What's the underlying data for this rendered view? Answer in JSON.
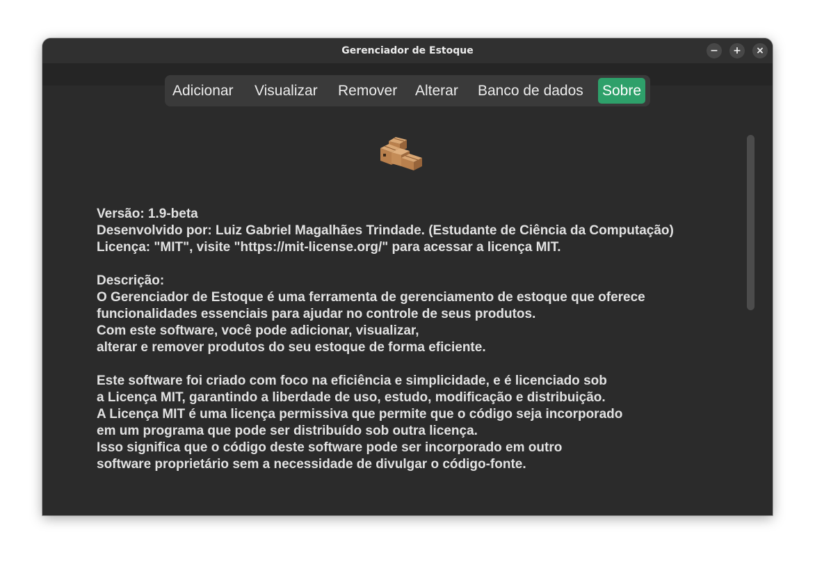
{
  "window": {
    "title": "Gerenciador de Estoque"
  },
  "window_controls": {
    "minimize": "−",
    "maximize": "+",
    "close": "×"
  },
  "tabs": [
    {
      "label": "Adicionar",
      "active": false
    },
    {
      "label": "Visualizar",
      "active": false
    },
    {
      "label": "Remover",
      "active": false
    },
    {
      "label": "Alterar",
      "active": false
    },
    {
      "label": "Banco de dados",
      "active": false
    },
    {
      "label": "Sobre",
      "active": true
    }
  ],
  "logo": {
    "icon": "package-boxes-icon"
  },
  "about": {
    "lines": [
      "Versão: 1.9-beta",
      "Desenvolvido por: Luiz Gabriel Magalhães Trindade. (Estudante de Ciência da Computação)",
      "Licença: \"MIT\", visite \"https://mit-license.org/\" para acessar a licença MIT.",
      "",
      "Descrição:",
      "O Gerenciador de Estoque é uma ferramenta de gerenciamento de estoque que oferece",
      "funcionalidades essenciais para ajudar no controle de seus produtos.",
      "Com este software, você pode adicionar, visualizar,",
      "alterar e remover produtos do seu estoque de forma eficiente.",
      "",
      "Este software foi criado com foco na eficiência e simplicidade, e é licenciado sob",
      "a Licença MIT, garantindo a liberdade de uso, estudo, modificação e distribuição.",
      "A Licença MIT é uma licença permissiva que permite que o código seja incorporado",
      "em um programa que pode ser distribuído sob outra licença.",
      "Isso significa que o código deste software pode ser incorporado em outro",
      "software proprietário sem a necessidade de divulgar o código-fonte."
    ]
  },
  "colors": {
    "accent": "#2ea06a",
    "window_bg": "#2b2b2b",
    "text": "#e2e2e2"
  }
}
